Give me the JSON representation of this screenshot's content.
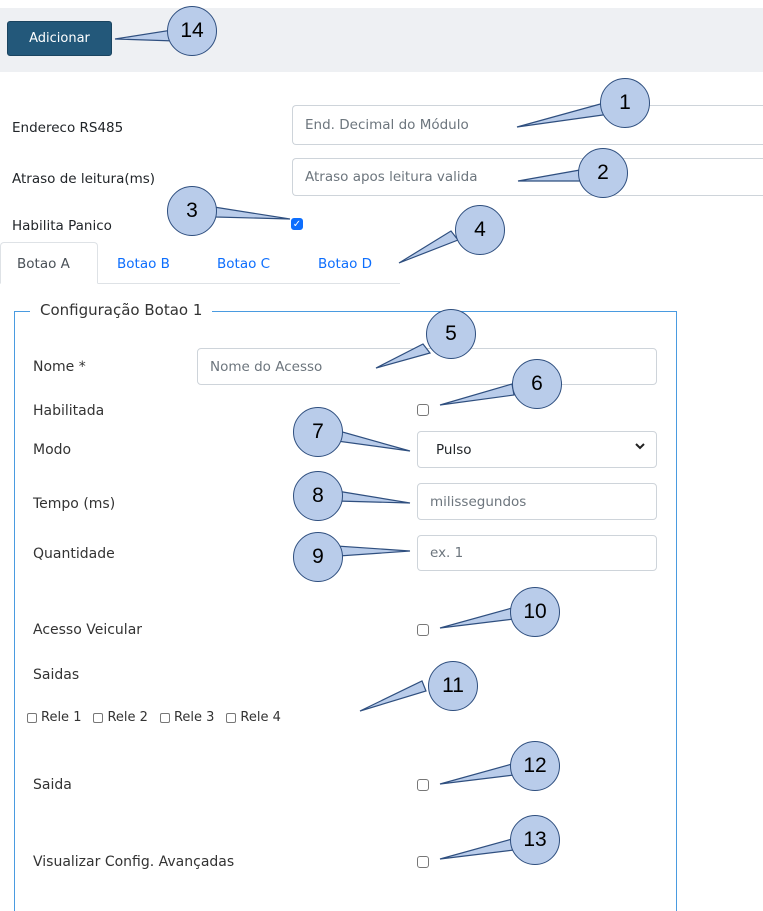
{
  "toolbar": {
    "add_label": "Adicionar"
  },
  "form": {
    "endereco": {
      "label": "Endereco RS485",
      "placeholder": "End. Decimal do Módulo"
    },
    "atraso": {
      "label": "Atraso de leitura(ms)",
      "placeholder": "Atraso apos leitura valida"
    },
    "panico": {
      "label": "Habilita Panico",
      "checked": true
    }
  },
  "tabs": [
    {
      "label": "Botao A",
      "active": true
    },
    {
      "label": "Botao B",
      "active": false
    },
    {
      "label": "Botao C",
      "active": false
    },
    {
      "label": "Botao D",
      "active": false
    }
  ],
  "config": {
    "legend": "Configuração Botao 1",
    "nome": {
      "label": "Nome *",
      "placeholder": "Nome do Acesso"
    },
    "habilitada": {
      "label": "Habilitada",
      "checked": false
    },
    "modo": {
      "label": "Modo",
      "value": "Pulso"
    },
    "tempo": {
      "label": "Tempo (ms)",
      "placeholder": "milissegundos"
    },
    "quantidade": {
      "label": "Quantidade",
      "placeholder": "ex. 1"
    },
    "acesso_veicular": {
      "label": "Acesso Veicular",
      "checked": false
    },
    "saidas": {
      "label": "Saidas",
      "reles": [
        "Rele 1",
        "Rele 2",
        "Rele 3",
        "Rele 4"
      ]
    },
    "saida": {
      "label": "Saida",
      "checked": false
    },
    "avancadas": {
      "label": "Visualizar Config. Avançadas",
      "checked": false
    }
  },
  "callouts": [
    "1",
    "2",
    "3",
    "4",
    "5",
    "6",
    "7",
    "8",
    "9",
    "10",
    "11",
    "12",
    "13",
    "14"
  ],
  "colors": {
    "button": "#23587a",
    "accent": "#0d6efd",
    "fieldset_border": "#4a9be0",
    "callout_fill": "#b9ccea"
  }
}
